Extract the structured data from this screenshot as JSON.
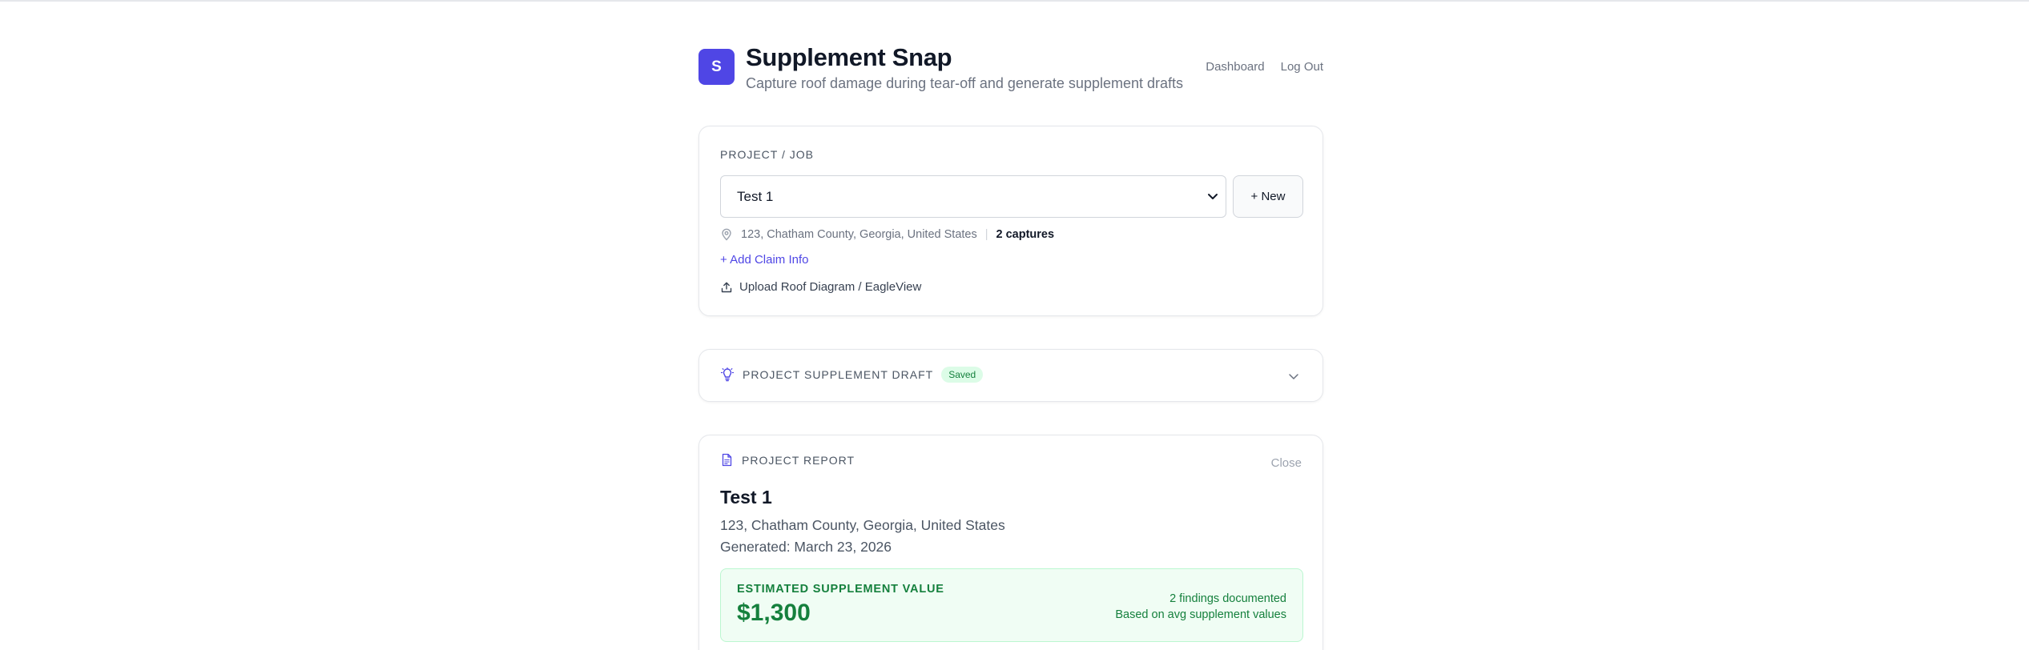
{
  "header": {
    "logo_letter": "S",
    "title": "Supplement Snap",
    "subtitle": "Capture roof damage during tear-off and generate supplement drafts",
    "nav": {
      "dashboard": "Dashboard",
      "logout": "Log Out"
    }
  },
  "project": {
    "label": "PROJECT / JOB",
    "selected": "Test 1",
    "new_button": "+ New",
    "address": "123, Chatham County, Georgia, United States",
    "captures": "2 captures",
    "add_claim": "+ Add Claim Info",
    "upload": "Upload Roof Diagram / EagleView"
  },
  "draft": {
    "label": "PROJECT SUPPLEMENT DRAFT",
    "badge": "Saved"
  },
  "report": {
    "label": "PROJECT REPORT",
    "close": "Close",
    "title": "Test 1",
    "address": "123, Chatham County, Georgia, United States",
    "generated": "Generated: March 23, 2026",
    "value_label": "ESTIMATED SUPPLEMENT VALUE",
    "value_amount": "$1,300",
    "findings": "2 findings documented",
    "basis": "Based on avg supplement values"
  },
  "colors": {
    "accent": "#4f46e5",
    "success": "#15803d",
    "success_bg": "#f0fdf4"
  }
}
